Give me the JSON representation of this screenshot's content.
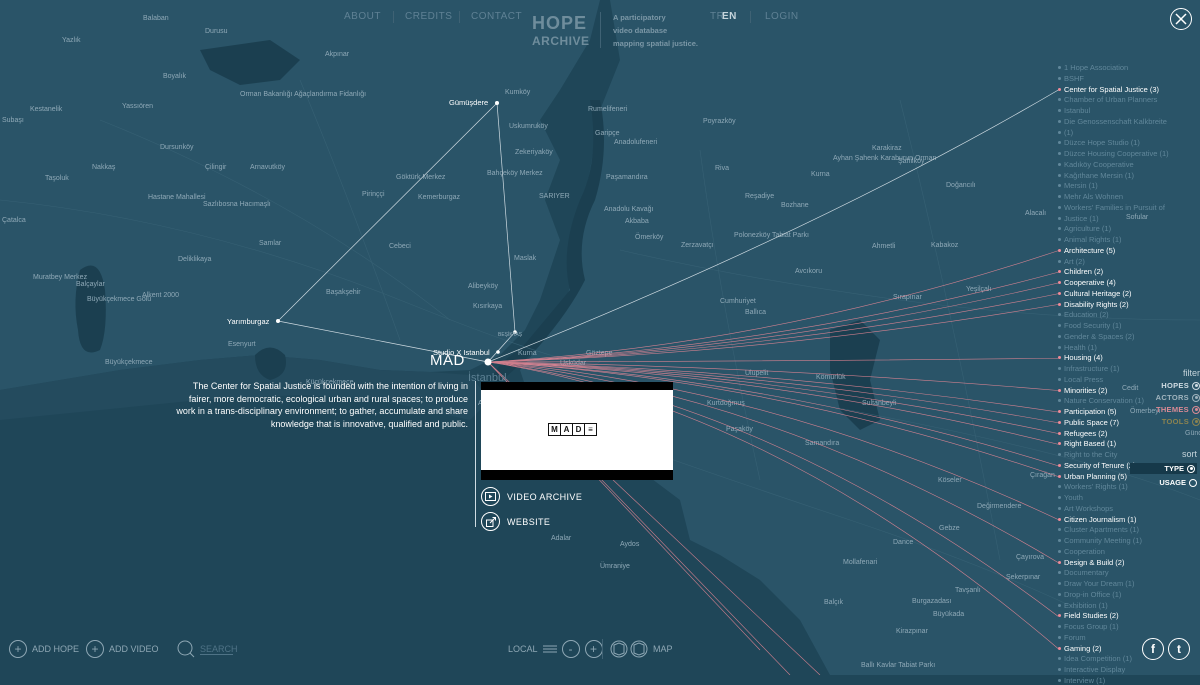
{
  "nav": {
    "about": "ABOUT",
    "credits": "CREDITS",
    "contact": "CONTACT",
    "lang_tr": "TR",
    "lang_en": "EN",
    "login": "LOGIN"
  },
  "logo": {
    "line1": "HOPE",
    "line2": "ARCHIVE"
  },
  "tagline": [
    "A participatory",
    "video database",
    "mapping spatial justice."
  ],
  "map_places": [
    "Balaban",
    "Yazlık",
    "Durusu",
    "Akpınar",
    "Boyalık",
    "Yassıören",
    "Orman Bakanlığı Ağaçlandırma Fidanlığı",
    "Kestanelik",
    "Subaşı",
    "Dursunköy",
    "Nakkaş",
    "Çilingir",
    "Arnavutköy",
    "Göktürk Merkez",
    "Pirinççi",
    "Kemerburgaz",
    "Taşoluk",
    "Hastane Mahallesi",
    "Sazlıbosna Hacımaşlı",
    "Çatalca",
    "Samlar",
    "Cebeci",
    "Deliklikaya",
    "Kısırkaya",
    "Kumköy",
    "Uskumruköy",
    "Zekeriyaköy",
    "Bahçeköy Merkez",
    "SARIYER",
    "Maslak",
    "Alibeyköy",
    "Başakşehir",
    "Alkent 2000",
    "Balçaylar",
    "Muratbey Merkez",
    "Büyükçekmece Gölü",
    "Esenyurt",
    "Büyükçekmece",
    "Küçükçekmece",
    "Rumelifeneri",
    "Garipçe",
    "Anadolufeneri",
    "Poyrazköy",
    "Riva",
    "Paşamandıra",
    "Anadolu Kavağı",
    "Akbaba",
    "Ömerköy",
    "Zerzavatçı",
    "Polonezköy Tabiat Parkı",
    "Cumhuriyet",
    "Reşadiye",
    "Bozhane",
    "Ayhan Şahenk Karaburun Orman",
    "Kurna",
    "Karakiraz",
    "Şahilköy",
    "Doğancılı",
    "Alacalı",
    "Sofular",
    "Ahmetli",
    "Kabakoz",
    "Avcıkoru",
    "Yeşilçalı",
    "Sırapınar",
    "Ulupelit",
    "Kömürlük",
    "Paşaköy",
    "Kurtdoğmuş",
    "Sultanbeyli",
    "Samandıra",
    "Ballıca",
    "Kurna",
    "Alemdağ Ömer",
    "Üsküdar",
    "Göztepe",
    "Aydos",
    "Ümraniye",
    "Adalar",
    "Büyükada",
    "Burgazadası",
    "Tavşanlı",
    "Kirazpınar",
    "Ballı Kavlar Tabiat Parkı",
    "Gebze",
    "Dance",
    "Mollafenari",
    "Balçık",
    "Şekerpınar",
    "Çayırova",
    "Köseler",
    "Değirmendere",
    "Çırağan",
    "Cedit",
    "Gündoğdu",
    "Ömerbeyi",
    "Hasanpaşa",
    "Taşlıçiftlik",
    "Tavşancıl"
  ],
  "nodes": {
    "gumusdere": "Gümüşdere",
    "yarimburgaz": "Yarımburgaz",
    "studio_x": "Studio X Istanbul",
    "beşiktaş": "BEŞİKTAŞ",
    "kadikoy": "Kadıköy",
    "istanbul": "İstanbul"
  },
  "selected": {
    "title": "MAD",
    "description": "The Center for Spatial Justice is founded with the intention of living in fairer, more democratic, ecological urban and rural spaces; to produce work in a trans-disciplinary environment; to gather, accumulate and share knowledge that is innovative, qualified and public.",
    "video_logo": [
      "M",
      "A",
      "D",
      "≡"
    ],
    "video_archive_label": "VIDEO ARCHIVE",
    "website_label": "WEBSITE"
  },
  "legend": [
    {
      "label": "1 Hope Association",
      "active": false
    },
    {
      "label": "BSHF",
      "active": false
    },
    {
      "label": "Center for Spatial Justice (3)",
      "active": true
    },
    {
      "label": "Chamber of Urban Planners",
      "active": false
    },
    {
      "label": "Istanbul",
      "active": false
    },
    {
      "label": "Die Genossenschaft Kalkbreite",
      "active": false
    },
    {
      "label": "(1)",
      "active": false
    },
    {
      "label": "Düzce Hope Studio (1)",
      "active": false
    },
    {
      "label": "Düzce Housing Cooperative (1)",
      "active": false
    },
    {
      "label": "Kadıköy Cooperative",
      "active": false
    },
    {
      "label": "Kağıthane Mersin (1)",
      "active": false
    },
    {
      "label": "Mersin (1)",
      "active": false
    },
    {
      "label": "Mehr Als Wohnen",
      "active": false
    },
    {
      "label": "Workers' Families in Pursuit of",
      "active": false
    },
    {
      "label": "Justice (1)",
      "active": false
    },
    {
      "label": "Agriculture (1)",
      "active": false
    },
    {
      "label": "Animal Rights (1)",
      "active": false
    },
    {
      "label": "Architecture (5)",
      "active": true
    },
    {
      "label": "Art (2)",
      "active": false
    },
    {
      "label": "Children (2)",
      "active": true
    },
    {
      "label": "Cooperative (4)",
      "active": true
    },
    {
      "label": "Cultural Heritage (2)",
      "active": true
    },
    {
      "label": "Disability Rights (2)",
      "active": true
    },
    {
      "label": "Education (2)",
      "active": false
    },
    {
      "label": "Food Security (1)",
      "active": false
    },
    {
      "label": "Gender & Spaces (2)",
      "active": false
    },
    {
      "label": "Health (1)",
      "active": false
    },
    {
      "label": "Housing (4)",
      "active": true
    },
    {
      "label": "Infrastructure (1)",
      "active": false
    },
    {
      "label": "Local Press",
      "active": false
    },
    {
      "label": "Minorities (2)",
      "active": true
    },
    {
      "label": "Nature Conservation (1)",
      "active": false
    },
    {
      "label": "Participation (5)",
      "active": true
    },
    {
      "label": "Public Space (7)",
      "active": true
    },
    {
      "label": "Refugees (2)",
      "active": true
    },
    {
      "label": "Right Based (1)",
      "active": true
    },
    {
      "label": "Right to the City",
      "active": false
    },
    {
      "label": "Security of Tenure (2)",
      "active": true
    },
    {
      "label": "Urban Planning (5)",
      "active": true
    },
    {
      "label": "Workers' Rights (1)",
      "active": false
    },
    {
      "label": "Youth",
      "active": false
    },
    {
      "label": "Art Workshops",
      "active": false
    },
    {
      "label": "Citizen Journalism (1)",
      "active": true
    },
    {
      "label": "Cluster Apartments (1)",
      "active": false
    },
    {
      "label": "Community Meeting (1)",
      "active": false
    },
    {
      "label": "Cooperation",
      "active": false
    },
    {
      "label": "Design & Build (2)",
      "active": true
    },
    {
      "label": "Documentary",
      "active": false
    },
    {
      "label": "Draw Your Dream (1)",
      "active": false
    },
    {
      "label": "Drop-in Office (1)",
      "active": false
    },
    {
      "label": "Exhibition (1)",
      "active": false
    },
    {
      "label": "Field Studies (2)",
      "active": true
    },
    {
      "label": "Focus Group (1)",
      "active": false
    },
    {
      "label": "Forum",
      "active": false
    },
    {
      "label": "Gaming (2)",
      "active": true
    },
    {
      "label": "Idea Competition (1)",
      "active": false
    },
    {
      "label": "Interactive Display",
      "active": false
    },
    {
      "label": "Interview (1)",
      "active": false
    }
  ],
  "filter": {
    "header": "filter",
    "items": [
      {
        "label": "HOPES",
        "color": "#cfdbe2",
        "filled": true
      },
      {
        "label": "ACTORS",
        "color": "#9fb3bd",
        "filled": true
      },
      {
        "label": "THEMES",
        "color": "#d98a95",
        "filled": true
      },
      {
        "label": "TOOLS",
        "color": "#8c8350",
        "filled": true
      }
    ]
  },
  "sort": {
    "header": "sort",
    "items": [
      {
        "label": "TYPE",
        "selected": true
      },
      {
        "label": "USAGE",
        "selected": false
      }
    ]
  },
  "bottom": {
    "add_hope": "ADD HOPE",
    "add_video": "ADD VIDEO",
    "search_placeholder": "SEARCH",
    "local": "LOCAL",
    "map": "MAP",
    "facebook": "f",
    "twitter": "t"
  },
  "colors": {
    "background": "#1f4658",
    "land": "#2a5468",
    "active_line": "#f08a98",
    "white_line": "#cfdbe2"
  }
}
